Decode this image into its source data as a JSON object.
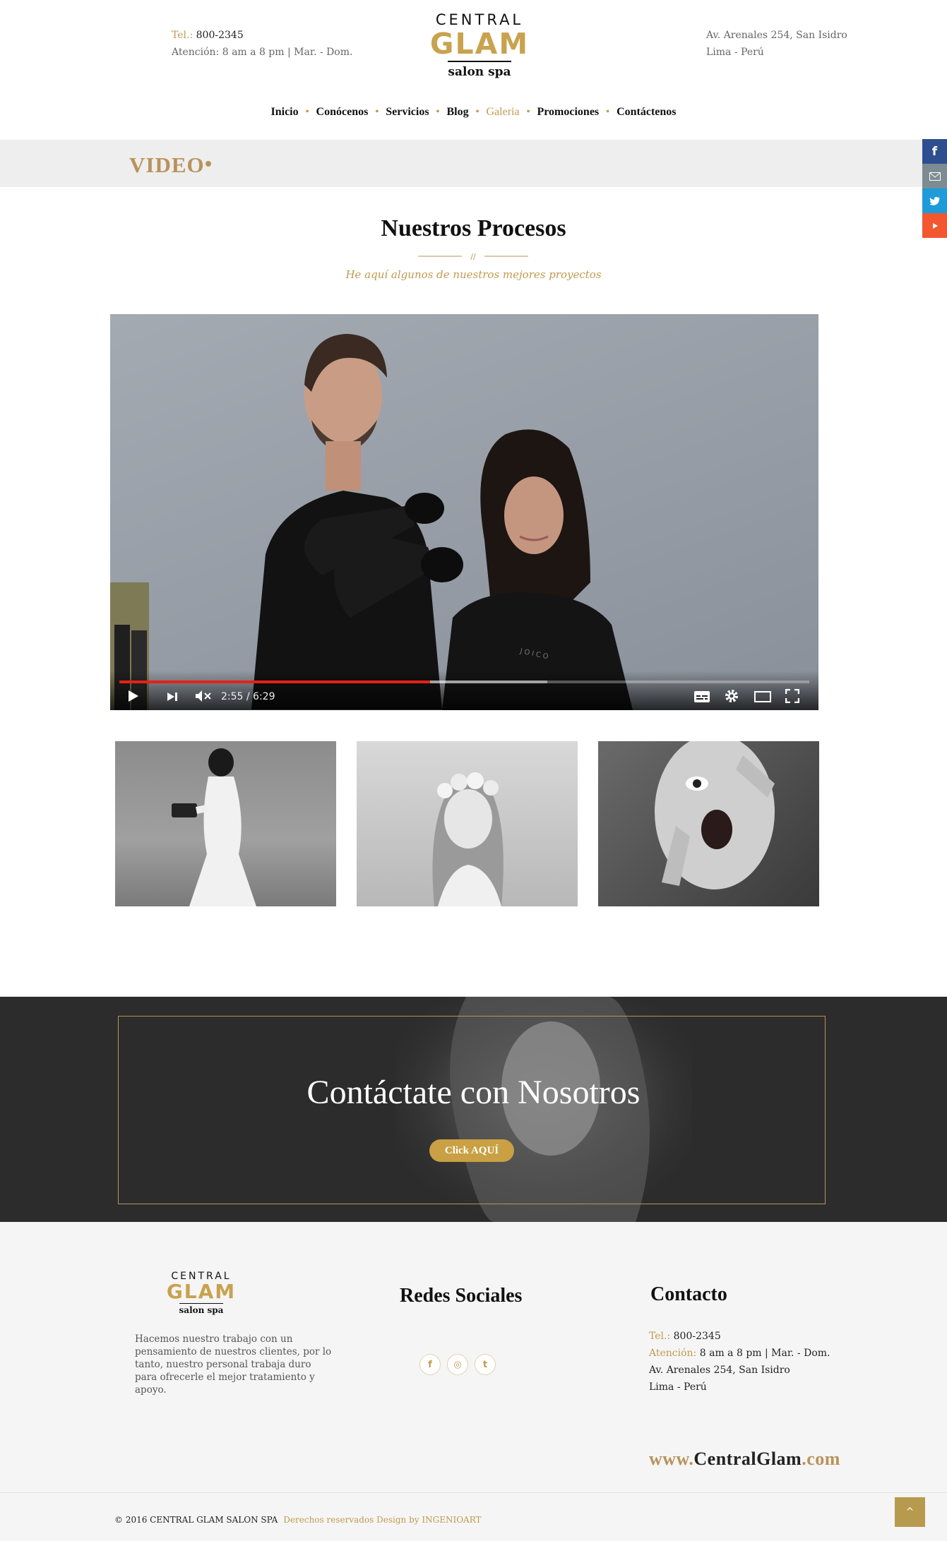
{
  "header": {
    "tel_label": "Tel.:",
    "tel_value": "800-2345",
    "hours": "Atención: 8 am a 8 pm  |  Mar. - Dom.",
    "address_line1": "Av. Arenales  254, San Isidro",
    "address_line2": "Lima - Perú",
    "logo": {
      "line1": "CENTRAL",
      "line2": "GLAM",
      "line3": "salon spa"
    }
  },
  "nav": {
    "items": [
      "Inicio",
      "Conócenos",
      "Servicios",
      "Blog",
      "Galeria",
      "Promociones",
      "Contáctenos"
    ],
    "active": "Galeria"
  },
  "page_band": {
    "title": "VIDEO"
  },
  "side_social": [
    "facebook-icon",
    "email-icon",
    "twitter-icon",
    "youtube-icon"
  ],
  "section": {
    "title": "Nuestros Procesos",
    "separator": "//",
    "subtitle": "He aquí algunos de nuestros mejores proyectos"
  },
  "video": {
    "time": "2:55 / 6:29",
    "progress": 0.45,
    "buffered": 0.62,
    "apron_text": "JOICO"
  },
  "gallery": [
    "bride-photo",
    "flower-crown-photo",
    "surprised-woman-photo"
  ],
  "cta": {
    "title": "Contáctate con Nosotros",
    "button": "Click AQUÍ"
  },
  "footer": {
    "logo": {
      "line1": "CENTRAL",
      "line2": "GLAM",
      "line3": "salon spa"
    },
    "description": "Hacemos nuestro trabajo con un pensamiento de nuestros clientes, por lo tanto, nuestro personal trabaja duro para ofrecerle el mejor tratamiento y apoyo.",
    "social_heading": "Redes Sociales",
    "social_icons": [
      "f",
      "◎",
      "t"
    ],
    "contact_heading": "Contacto",
    "tel_label": "Tel.:",
    "tel_value": "800-2345",
    "hours_label": "Atención:",
    "hours_value": "8 am a 8 pm  |  Mar. - Dom.",
    "address_line1": "Av. Arenales  254, San Isidro",
    "address_line2": "Lima - Perú",
    "web_prefix": "www.",
    "web_name": "CentralGlam",
    "web_suffix": ".com",
    "copyright": "© 2016   CENTRAL GLAM SALON SPA",
    "credits": "Derechos reservados Design by INGENIOART",
    "to_top": "^"
  },
  "colors": {
    "gold": "#c19a4f",
    "band": "#eeeeee",
    "dark_banner": "#2c2c2c",
    "progress": "#e62117"
  }
}
